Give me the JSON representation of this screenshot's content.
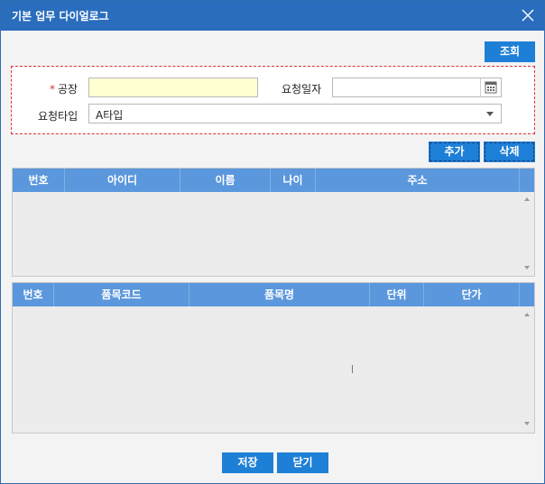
{
  "window": {
    "title": "기본 업무 다이얼로그"
  },
  "toolbar": {
    "search_label": "조회"
  },
  "search_form": {
    "factory_label": "공장",
    "required_mark": "*",
    "factory_value": "",
    "request_date_label": "요청일자",
    "request_date_value": "",
    "request_type_label": "요청타입",
    "request_type_value": "A타입"
  },
  "grid_actions": {
    "add_label": "추가",
    "delete_label": "삭제"
  },
  "grid1": {
    "columns": [
      "번호",
      "아이디",
      "이름",
      "나이",
      "주소"
    ],
    "rows": []
  },
  "grid2": {
    "columns": [
      "번호",
      "품목코드",
      "품목명",
      "단위",
      "단가"
    ],
    "rows": []
  },
  "footer": {
    "save_label": "저장",
    "close_label": "닫기"
  },
  "colors": {
    "titlebar": "#2a6dbd",
    "button": "#1e7fd6",
    "grid_header": "#5b97dc",
    "required": "#e0302f",
    "required_field": "#ffffd2"
  }
}
